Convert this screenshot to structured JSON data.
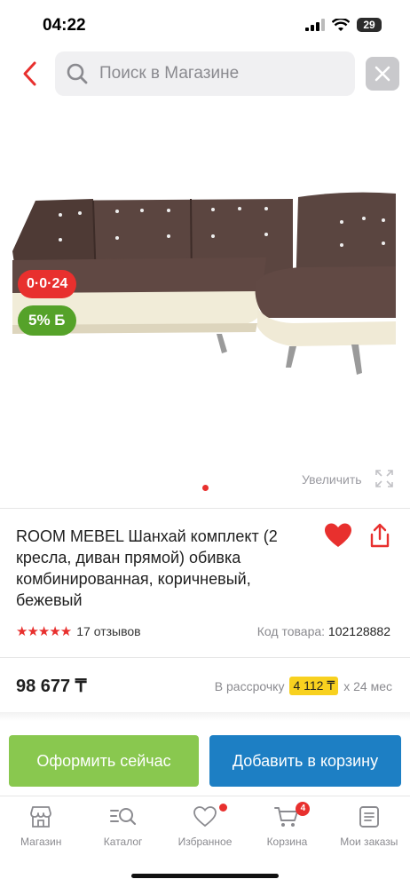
{
  "status_bar": {
    "time": "04:22",
    "battery": "29"
  },
  "search": {
    "placeholder": "Поиск в Магазине"
  },
  "product": {
    "timer_badge": "0·0·24",
    "bonus_badge": "5% Б",
    "zoom_label": "Увеличить",
    "title": "ROOM MEBEL Шанхай комплект (2 кресла, диван прямой) обивка комбинированная, коричневый, бежевый",
    "stars": "★★★★★",
    "reviews": "17 отзывов",
    "code_label": "Код товара:",
    "code_value": "102128882",
    "price": "98 677 ₸",
    "installment_prefix": "В рассрочку",
    "installment_amount": "4 112 ₸",
    "installment_suffix": "х 24 мес"
  },
  "actions": {
    "checkout": "Оформить сейчас",
    "add_to_cart": "Добавить в корзину"
  },
  "tabbar": {
    "items": [
      {
        "label": "Магазин",
        "icon": "shop-icon"
      },
      {
        "label": "Каталог",
        "icon": "catalog-icon"
      },
      {
        "label": "Избранное",
        "icon": "heart-icon"
      },
      {
        "label": "Корзина",
        "icon": "cart-icon",
        "badge": "4"
      },
      {
        "label": "Мои заказы",
        "icon": "orders-icon"
      }
    ]
  },
  "colors": {
    "accent": "#e8302e",
    "green": "#89c84f",
    "blue": "#1d7fc4",
    "highlight": "#f8d11f"
  }
}
